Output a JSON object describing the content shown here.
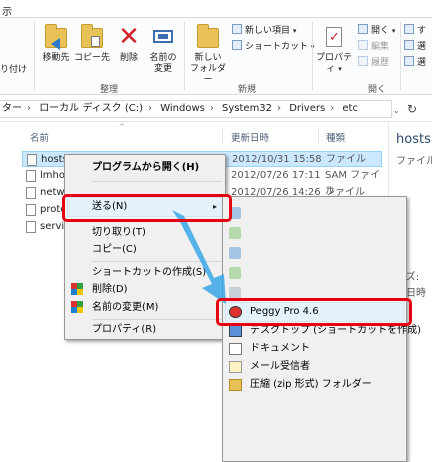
{
  "ribbon": {
    "top_left_text": "示",
    "left_cut_text": "り付け",
    "move_to": "移動先",
    "copy_to": "コピー先",
    "delete": "削除",
    "rename_line1": "名前の",
    "rename_line2": "変更",
    "new_folder_line1": "新しい",
    "new_folder_line2": "フォルダー",
    "new_item": "新しい項目",
    "shortcut": "ショートカット",
    "properties": "プロパティ",
    "open": "開く",
    "edit": "編集",
    "history": "履歴",
    "right_cut_1": "す",
    "right_cut_2": "選",
    "right_cut_3": "選",
    "group_organize": "整理",
    "group_new": "新規",
    "group_open": "開く"
  },
  "address": {
    "crumbs": [
      "ター",
      "ローカル ディスク (C:)",
      "Windows",
      "System32",
      "Drivers",
      "etc"
    ],
    "refresh_icon": "refresh-icon"
  },
  "list": {
    "col_name": "名前",
    "col_date": "更新日時",
    "col_type": "種類",
    "rows": [
      {
        "name": "hosts",
        "date": "2012/10/31 15:58",
        "type": "ファイル"
      },
      {
        "name": "lmhos",
        "date": "2012/07/26 17:11",
        "type": "SAM ファイル"
      },
      {
        "name": "netwo",
        "date": "2012/07/26 14:26",
        "type": "ファイル"
      },
      {
        "name": "proto",
        "date": "",
        "type": ""
      },
      {
        "name": "servic",
        "date": "",
        "type": ""
      }
    ]
  },
  "right_pane": {
    "title": "hosts",
    "subtitle": "ファイル",
    "line1": "イズ:",
    "line2": "成日時"
  },
  "context_menu": {
    "open_with": "プログラムから開く(H)",
    "send_to": "送る(N)",
    "cut": "切り取り(T)",
    "copy": "コピー(C)",
    "create_shortcut": "ショートカットの作成(S)",
    "delete": "削除(D)",
    "rename": "名前の変更(M)",
    "properties": "プロパティ(R)"
  },
  "send_to_menu": {
    "peggy": "Peggy Pro 4.6",
    "desktop": "デスクトップ (ショートカットを作成)",
    "documents": "ドキュメント",
    "mail": "メール受信者",
    "zip": "圧縮 (zip 形式) フォルダー"
  },
  "colors": {
    "highlight_border": "#e60012",
    "arrow": "#3aa7e6",
    "selection": "#cce8ff"
  }
}
